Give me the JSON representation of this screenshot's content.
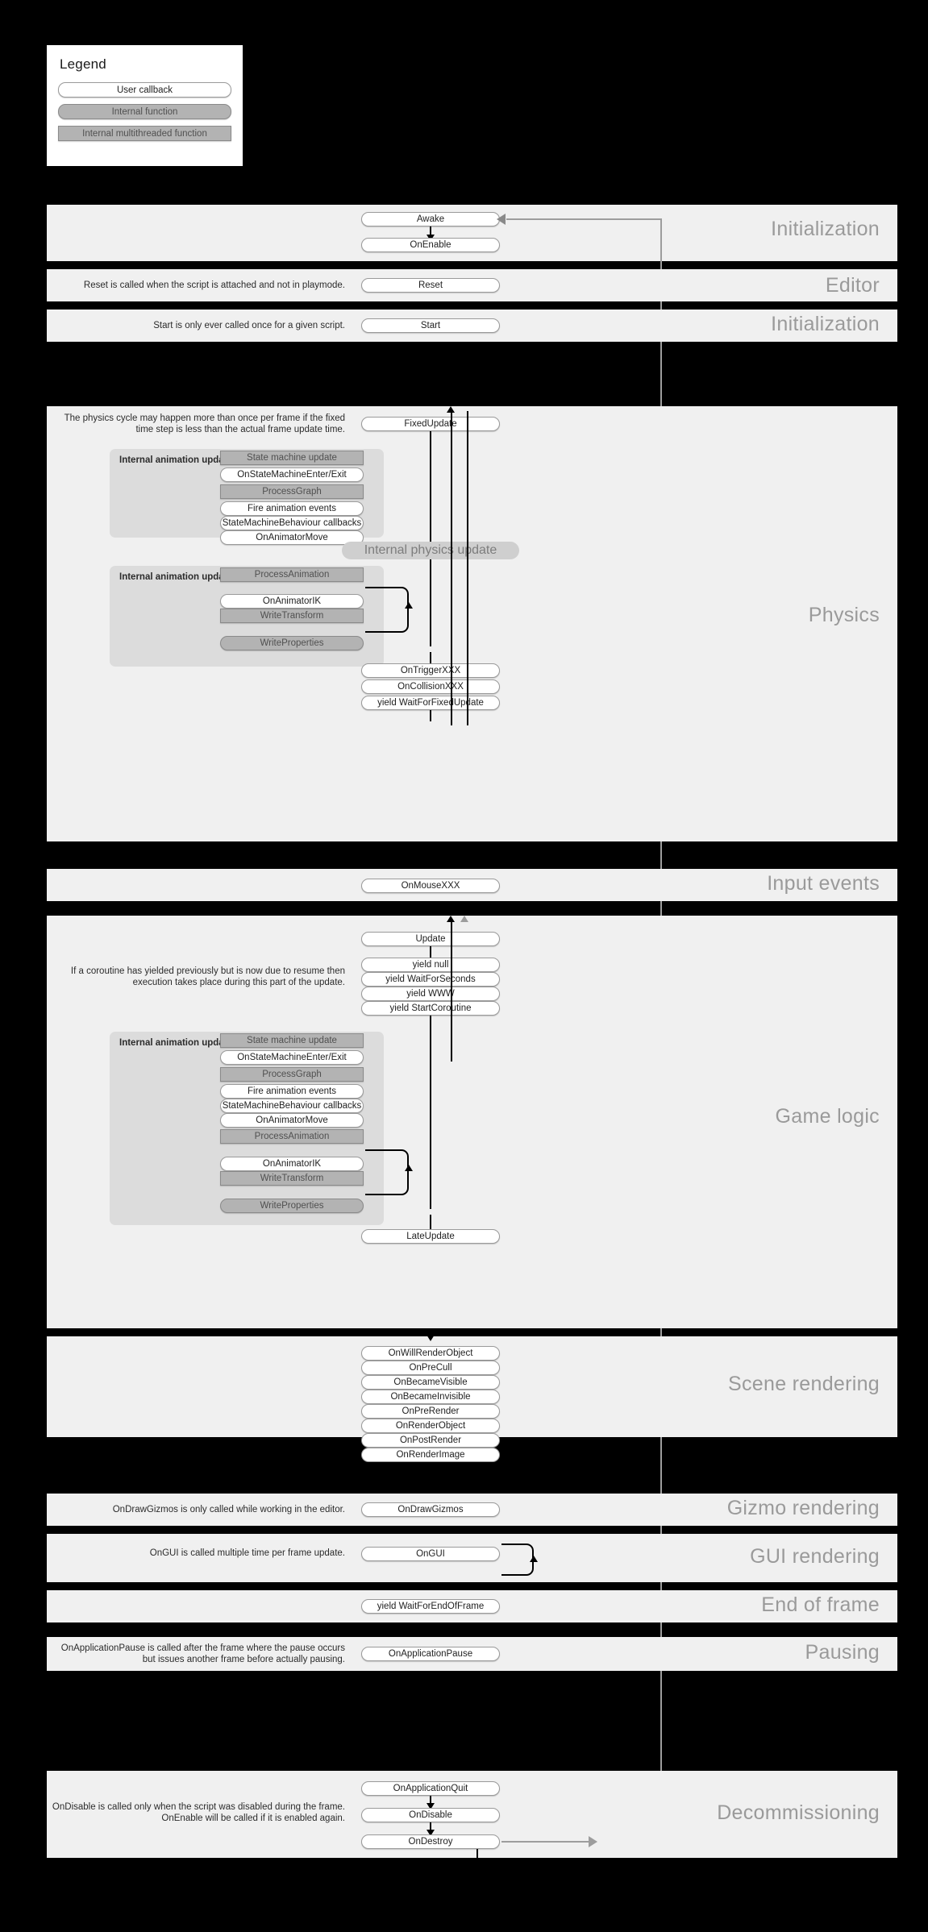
{
  "legend": {
    "title": "Legend",
    "items": [
      {
        "label": "User callback",
        "style": "user"
      },
      {
        "label": "Internal function",
        "style": "internal"
      },
      {
        "label": "Internal multithreaded function",
        "style": "multithreaded"
      }
    ]
  },
  "sections": [
    {
      "id": "initialization-1",
      "label": "Initialization",
      "note": "",
      "nodes": [
        "Awake",
        "OnEnable"
      ]
    },
    {
      "id": "editor",
      "label": "Editor",
      "note": "Reset is called when the script is attached and not in playmode.",
      "nodes": [
        "Reset"
      ]
    },
    {
      "id": "initialization-2",
      "label": "Initialization",
      "note": "Start is only ever called once for a given script.",
      "nodes": [
        "Start"
      ]
    },
    {
      "id": "physics",
      "label": "Physics",
      "note": "The physics cycle may happen more than once per frame if the fixed time step is less than the actual frame update time.",
      "nodes": [
        "FixedUpdate",
        "State machine update",
        "OnStateMachineEnter/Exit",
        "ProcessGraph",
        "Fire animation events",
        "StateMachineBehaviour callbacks",
        "OnAnimatorMove",
        "Internal physics update",
        "ProcessAnimation",
        "OnAnimatorIK",
        "WriteTransform",
        "WriteProperties",
        "OnTriggerXXX",
        "OnCollisionXXX",
        "yield WaitForFixedUpdate"
      ],
      "anim_group_label": "Internal animation update"
    },
    {
      "id": "input-events",
      "label": "Input events",
      "note": "",
      "nodes": [
        "OnMouseXXX"
      ]
    },
    {
      "id": "game-logic",
      "label": "Game logic",
      "note": "If a coroutine has yielded previously but is now due to resume then execution takes place during this part of the update.",
      "nodes": [
        "Update",
        "yield null",
        "yield WaitForSeconds",
        "yield WWW",
        "yield StartCoroutine",
        "State machine update",
        "OnStateMachineEnter/Exit",
        "ProcessGraph",
        "Fire animation events",
        "StateMachineBehaviour callbacks",
        "OnAnimatorMove",
        "ProcessAnimation",
        "OnAnimatorIK",
        "WriteTransform",
        "WriteProperties",
        "LateUpdate"
      ],
      "anim_group_label": "Internal animation update"
    },
    {
      "id": "scene-rendering",
      "label": "Scene rendering",
      "note": "",
      "nodes": [
        "OnWillRenderObject",
        "OnPreCull",
        "OnBecameVisible",
        "OnBecameInvisible",
        "OnPreRender",
        "OnRenderObject",
        "OnPostRender",
        "OnRenderImage"
      ]
    },
    {
      "id": "gizmo-rendering",
      "label": "Gizmo rendering",
      "note": "OnDrawGizmos is only called while working in the editor.",
      "nodes": [
        "OnDrawGizmos"
      ]
    },
    {
      "id": "gui-rendering",
      "label": "GUI rendering",
      "note": "OnGUI is called multiple time per frame update.",
      "nodes": [
        "OnGUI"
      ]
    },
    {
      "id": "end-of-frame",
      "label": "End of frame",
      "note": "",
      "nodes": [
        "yield WaitForEndOfFrame"
      ]
    },
    {
      "id": "pausing",
      "label": "Pausing",
      "note": "OnApplicationPause is called after the frame where the pause occurs but issues another frame before actually pausing.",
      "nodes": [
        "OnApplicationPause"
      ]
    },
    {
      "id": "decommissioning",
      "label": "Decommissioning",
      "note": "OnDisable is called only when the script was disabled during the frame. OnEnable will be called if it is enabled again.",
      "nodes": [
        "OnApplicationQuit",
        "OnDisable",
        "OnDestroy"
      ]
    }
  ],
  "colors": {
    "background": "#000000",
    "band": "#f0f0f0",
    "anim_group": "#dcdcdc",
    "physics_inner": "#e2e2e2",
    "user_callback": "#ffffff",
    "internal_function": "#b3b3b3",
    "section_label": "#9a9a9a",
    "line": "#000000",
    "line_grey": "#9d9d9d"
  }
}
